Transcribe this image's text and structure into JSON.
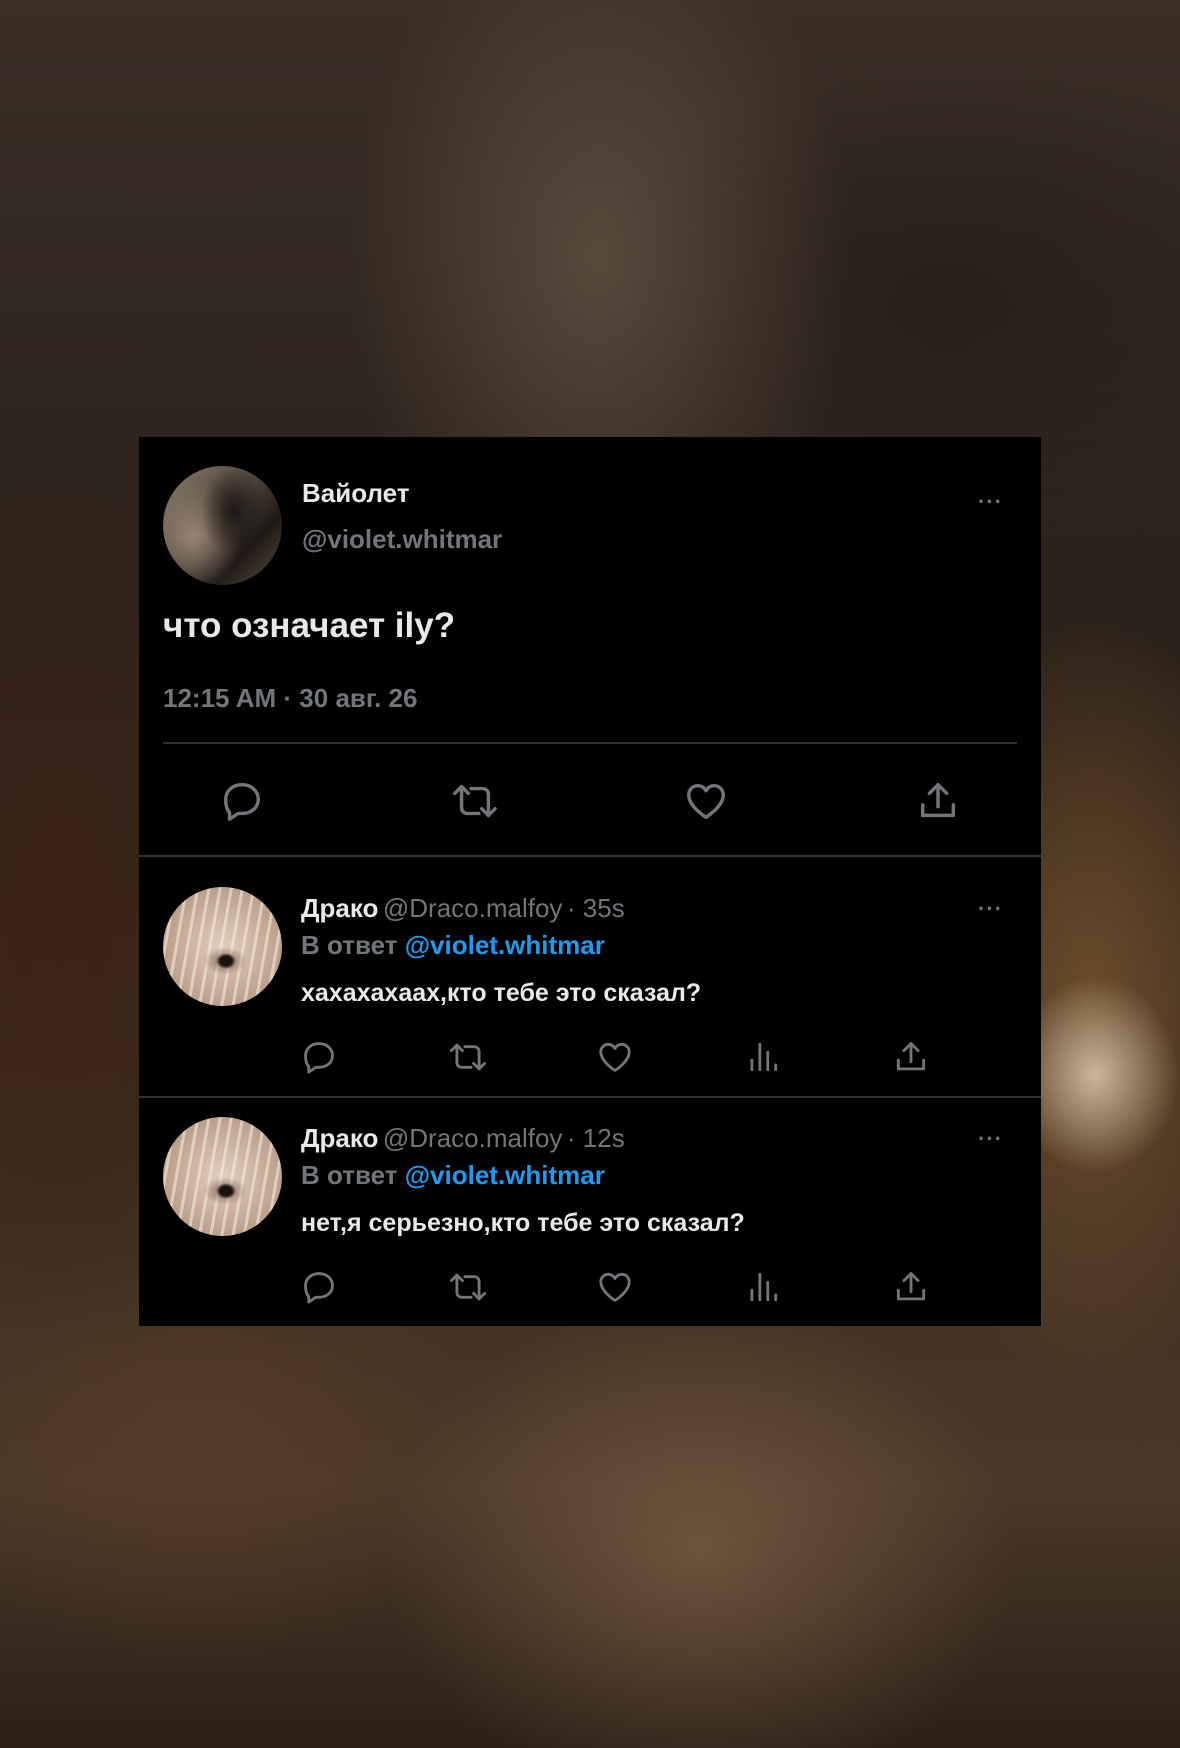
{
  "tweet": {
    "author_name": "Вайолет",
    "author_handle": "@violet.whitmar",
    "text": "что означает ily?",
    "timestamp": "12:15 AM · 30 авг. 26",
    "more_label": "···"
  },
  "replies": [
    {
      "author_name": "Драко",
      "author_handle": "@Draco.malfoy",
      "time_ago": "· 35s",
      "reply_prefix": "В ответ",
      "reply_mention": "@violet.whitmar",
      "text": "хахахахаах,кто тебе это сказал?",
      "more_label": "···"
    },
    {
      "author_name": "Драко",
      "author_handle": "@Draco.malfoy",
      "time_ago": "· 12s",
      "reply_prefix": "В ответ",
      "reply_mention": "@violet.whitmar",
      "text": "нет,я серьезно,кто тебе это сказал?",
      "more_label": "···"
    }
  ],
  "icons": [
    "reply-icon",
    "retweet-icon",
    "like-icon",
    "views-icon",
    "share-icon",
    "more-icon"
  ],
  "colors": {
    "background": "#000000",
    "text_primary": "#e7e9ea",
    "text_secondary": "#71767b",
    "mention": "#1d9bf0",
    "divider": "#2f3336"
  }
}
